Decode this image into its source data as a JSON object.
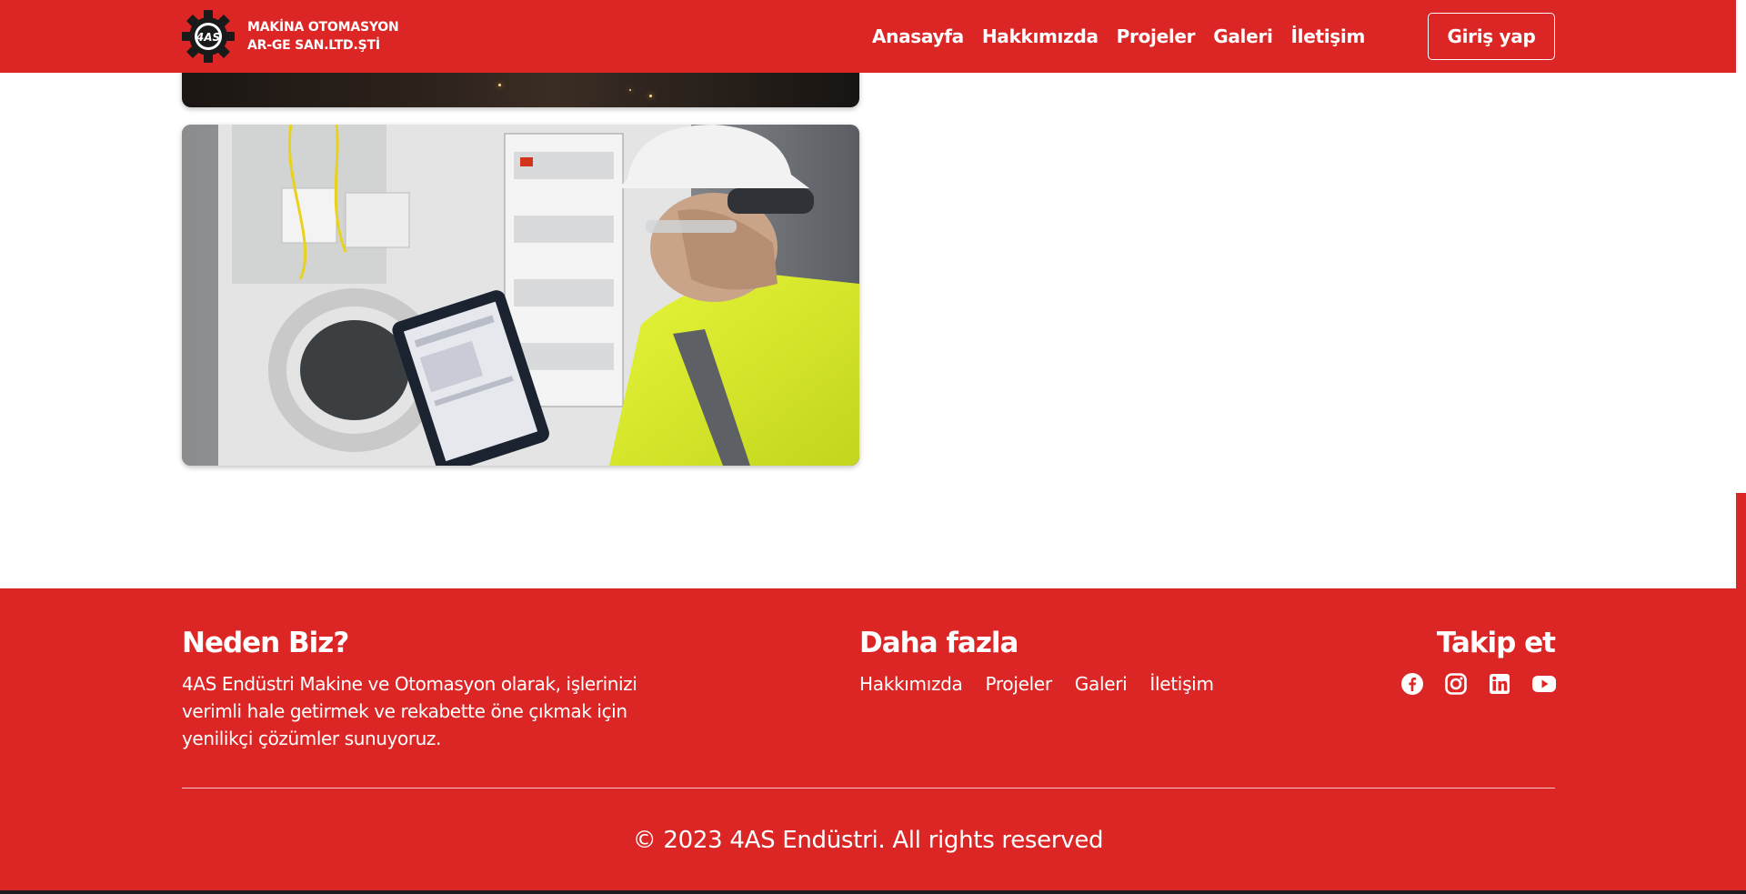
{
  "brand": {
    "logo_text": "4AS",
    "name_line1": "MAKİNA OTOMASYON",
    "name_line2": "AR-GE SAN.LTD.ŞTİ"
  },
  "nav": {
    "items": [
      {
        "label": "Anasayfa"
      },
      {
        "label": "Hakkımızda"
      },
      {
        "label": "Projeler"
      },
      {
        "label": "Galeri"
      },
      {
        "label": "İletişim"
      }
    ],
    "login_label": "Giriş yap"
  },
  "footer": {
    "why": {
      "title": "Neden Biz?",
      "text": "4AS Endüstri Makine ve Otomasyon olarak, işlerinizi verimli hale getirmek ve rekabette öne çıkmak için yenilikçi çözümler sunuyoruz."
    },
    "more": {
      "title": "Daha fazla",
      "links": [
        "Hakkımızda",
        "Projeler",
        "Galeri",
        "İletişim"
      ]
    },
    "follow": {
      "title": "Takip et",
      "icons": [
        "facebook-icon",
        "instagram-icon",
        "linkedin-icon",
        "youtube-icon"
      ]
    },
    "copyright": "© 2023 4AS Endüstri. All rights reserved"
  },
  "colors": {
    "brand_red": "#dc2626",
    "white": "#ffffff"
  },
  "images": [
    {
      "name": "welding-photo"
    },
    {
      "name": "electrician-tablet-photo"
    }
  ]
}
